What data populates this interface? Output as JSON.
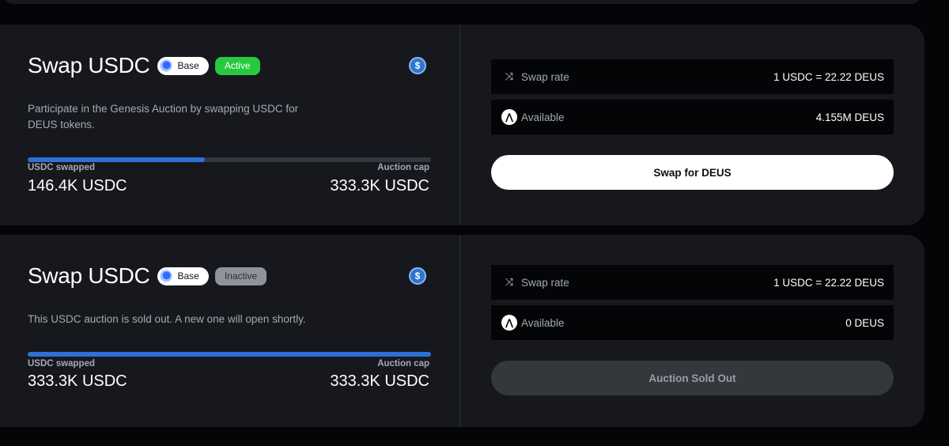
{
  "auctions": [
    {
      "title": "Swap USDC",
      "chain": "Base",
      "status": "Active",
      "description": "Participate in the Genesis Auction by swapping USDC for DEUS tokens.",
      "progress_percent": 43.9,
      "swapped_label": "USDC swapped",
      "swapped_value": "146.4K USDC",
      "cap_label": "Auction cap",
      "cap_value": "333.3K USDC",
      "rate_label": "Swap rate",
      "rate_value": "1  USDC = 22.22 DEUS",
      "available_label": "Available",
      "available_value": "4.155M DEUS",
      "action_label": "Swap for DEUS"
    },
    {
      "title": "Swap USDC",
      "chain": "Base",
      "status": "Inactive",
      "description": "This USDC auction is sold out. A new one will open shortly.",
      "progress_percent": 100,
      "swapped_label": "USDC swapped",
      "swapped_value": "333.3K USDC",
      "cap_label": "Auction cap",
      "cap_value": "333.3K USDC",
      "rate_label": "Swap rate",
      "rate_value": "1  USDC = 22.22 DEUS",
      "available_label": "Available",
      "available_value": "0 DEUS",
      "action_label": "Auction Sold Out"
    }
  ],
  "icons": {
    "coin": "usdc-coin-icon",
    "rate": "shuffle-icon",
    "available": "deus-token-icon"
  },
  "colors": {
    "active": "#27c93f",
    "inactive": "#8e939c",
    "progress": "#2e6fd8"
  }
}
